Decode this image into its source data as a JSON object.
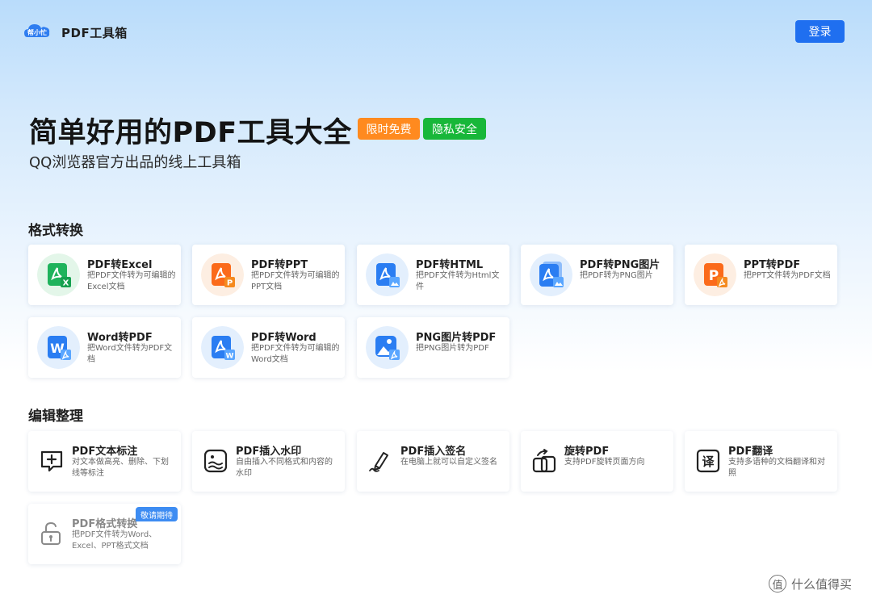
{
  "header": {
    "logo_text": "帮小忙",
    "app_name": "PDF工具箱",
    "login_label": "登录"
  },
  "hero": {
    "title": "简单好用的PDF工具大全",
    "badges": [
      "限时免费",
      "隐私安全"
    ],
    "subtitle": "QQ浏览器官方出品的线上工具箱"
  },
  "colors": {
    "accent": "#1f6ff0",
    "badge_orange": "#ff8a1f",
    "badge_green": "#18b739"
  },
  "sections": [
    {
      "title": "格式转换",
      "tools": [
        {
          "title": "PDF转Excel",
          "desc": "把PDF文件转为可编辑的Excel文档",
          "icon": "pdf-to-excel-icon"
        },
        {
          "title": "PDF转PPT",
          "desc": "把PDF文件转为可编辑的PPT文档",
          "icon": "pdf-to-ppt-icon"
        },
        {
          "title": "PDF转HTML",
          "desc": "把PDF文件转为Html文件",
          "icon": "pdf-to-html-icon"
        },
        {
          "title": "PDF转PNG图片",
          "desc": "把PDF转为PNG图片",
          "icon": "pdf-to-png-icon"
        },
        {
          "title": "PPT转PDF",
          "desc": "把PPT文件转为PDF文档",
          "icon": "ppt-to-pdf-icon"
        },
        {
          "title": "Word转PDF",
          "desc": "把Word文件转为PDF文档",
          "icon": "word-to-pdf-icon"
        },
        {
          "title": "PDF转Word",
          "desc": "把PDF文件转为可编辑的Word文档",
          "icon": "pdf-to-word-icon"
        },
        {
          "title": "PNG图片转PDF",
          "desc": "把PNG图片转为PDF",
          "icon": "png-to-pdf-icon"
        }
      ]
    },
    {
      "title": "编辑整理",
      "tools": [
        {
          "title": "PDF文本标注",
          "desc": "对文本做高亮、删除、下划线等标注",
          "icon": "annotate-icon"
        },
        {
          "title": "PDF插入水印",
          "desc": "自由插入不同格式和内容的水印",
          "icon": "watermark-icon"
        },
        {
          "title": "PDF插入签名",
          "desc": "在电脑上就可以自定义签名",
          "icon": "signature-icon"
        },
        {
          "title": "旋转PDF",
          "desc": "支持PDF旋转页面方向",
          "icon": "rotate-icon"
        },
        {
          "title": "PDF翻译",
          "desc": "支持多语种的文档翻译和对照",
          "icon": "translate-icon"
        },
        {
          "title": "PDF格式转换",
          "desc": "把PDF文件转为Word、Excel、PPT格式文档",
          "icon": "unlock-icon",
          "badge": "敬请期待"
        }
      ]
    }
  ],
  "watermark": {
    "icon_char": "值",
    "text": "什么值得买"
  }
}
